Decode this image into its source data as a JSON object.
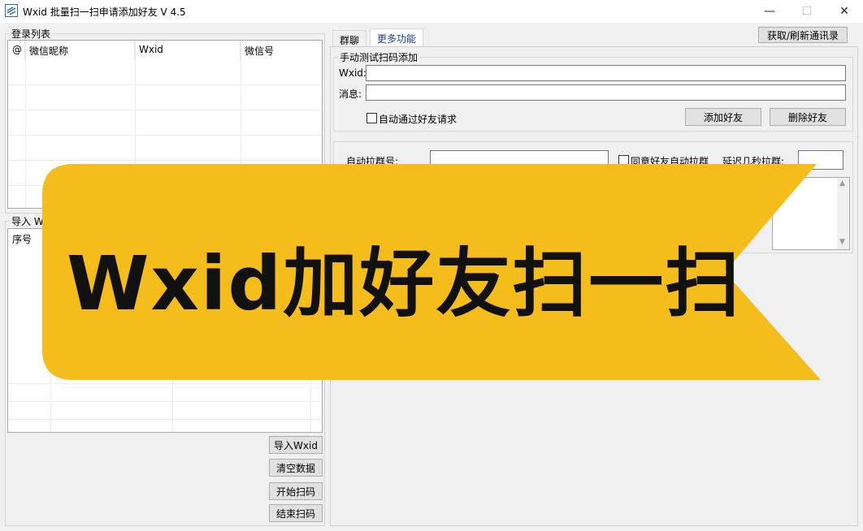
{
  "window": {
    "title": "Wxid 批量扫一扫申请添加好友 V 4.5",
    "minimize": "—",
    "maximize": "☐",
    "close": "✕"
  },
  "login_list": {
    "legend": "登录列表",
    "columns": [
      "@",
      "微信昵称",
      "Wxid",
      "微信号"
    ]
  },
  "import_panel": {
    "legend": "导入 W",
    "column": "序号",
    "buttons": {
      "import": "导入Wxid",
      "clear": "清空数据",
      "start": "开始扫码",
      "stop": "结束扫码"
    }
  },
  "tabs": [
    "群聊",
    "更多功能"
  ],
  "refresh_button": "获取/刷新通讯录",
  "manual_add": {
    "legend": "手动测试扫码添加",
    "wxid_label": "Wxid:",
    "message_label": "消息:",
    "auto_accept_label": "自动通过好友请求",
    "add_button": "添加好友",
    "delete_button": "删除好友"
  },
  "group_pull": {
    "auto_group_label": "自动拉群号:",
    "auto_pull_label": "同意好友自动拉群",
    "delay_label": "延迟几秒拉群:"
  },
  "banner": {
    "text": "Wxid加好友扫一扫",
    "color": "#f5bd1b"
  }
}
